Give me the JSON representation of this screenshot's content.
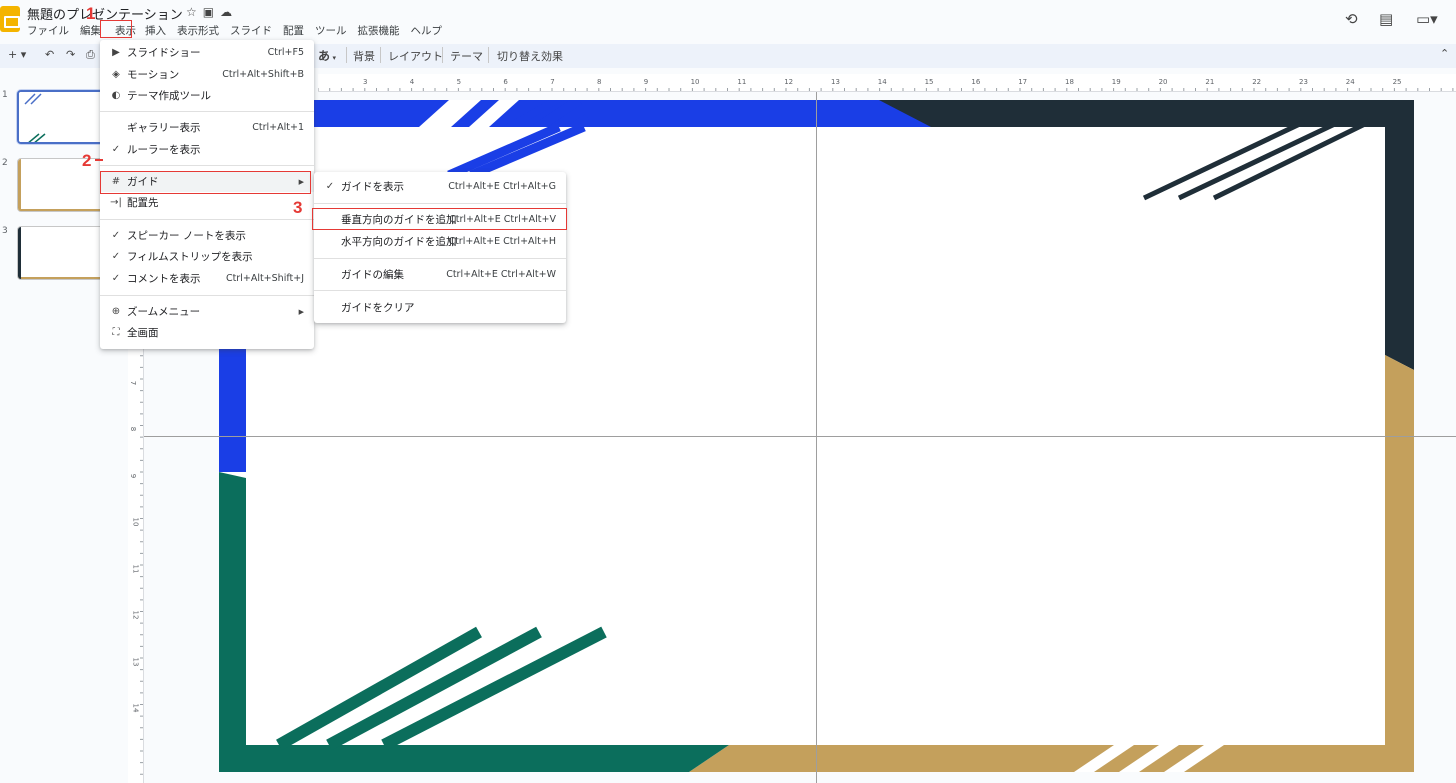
{
  "app": {
    "title": "無題のプレゼンテーション",
    "menu": [
      "ファイル",
      "編集",
      "表示",
      "挿入",
      "表示形式",
      "スライド",
      "配置",
      "ツール",
      "拡張機能",
      "ヘルプ"
    ]
  },
  "toolbar": {
    "font_button": "あ",
    "background": "背景",
    "layout": "レイアウト",
    "theme": "テーマ",
    "transition": "切り替え効果"
  },
  "ruler": {
    "h_ticks": [
      "3",
      "4",
      "5",
      "6",
      "7",
      "8",
      "9",
      "10",
      "11",
      "12",
      "13",
      "14",
      "15",
      "16",
      "17",
      "18",
      "19",
      "20",
      "21",
      "22",
      "23",
      "24",
      "25"
    ],
    "v_ticks": [
      "6",
      "7",
      "8",
      "9",
      "10",
      "11",
      "12",
      "13",
      "14"
    ]
  },
  "slides": [
    "1",
    "2",
    "3"
  ],
  "view_menu": {
    "items": [
      {
        "icon": "play-icon",
        "label": "スライドショー",
        "shortcut": "Ctrl+F5"
      },
      {
        "icon": "motion-icon",
        "label": "モーション",
        "shortcut": "Ctrl+Alt+Shift+B"
      },
      {
        "icon": "palette-icon",
        "label": "テーマ作成ツール",
        "shortcut": ""
      },
      {
        "icon": "",
        "label": "ギャラリー表示",
        "shortcut": "Ctrl+Alt+1"
      },
      {
        "icon": "check-icon",
        "label": "ルーラーを表示",
        "shortcut": ""
      },
      {
        "icon": "guide-icon",
        "label": "ガイド",
        "shortcut": ""
      },
      {
        "icon": "snap-icon",
        "label": "配置先",
        "shortcut": ""
      },
      {
        "icon": "check-icon",
        "label": "スピーカー ノートを表示",
        "shortcut": ""
      },
      {
        "icon": "check-icon",
        "label": "フィルムストリップを表示",
        "shortcut": ""
      },
      {
        "icon": "check-icon",
        "label": "コメントを表示",
        "shortcut": "Ctrl+Alt+Shift+J"
      },
      {
        "icon": "zoom-icon",
        "label": "ズームメニュー",
        "shortcut": ""
      },
      {
        "icon": "fullscreen-icon",
        "label": "全画面",
        "shortcut": ""
      }
    ]
  },
  "guide_menu": {
    "items": [
      {
        "label": "ガイドを表示",
        "shortcut": "Ctrl+Alt+E Ctrl+Alt+G"
      },
      {
        "label": "垂直方向のガイドを追加",
        "shortcut": "Ctrl+Alt+E Ctrl+Alt+V"
      },
      {
        "label": "水平方向のガイドを追加",
        "shortcut": "Ctrl+Alt+E Ctrl+Alt+H"
      },
      {
        "label": "ガイドの編集",
        "shortcut": "Ctrl+Alt+E Ctrl+Alt+W"
      },
      {
        "label": "ガイドをクリア",
        "shortcut": ""
      }
    ]
  },
  "annotations": [
    "1",
    "2",
    "3"
  ],
  "colors": {
    "accent_red": "#e53935",
    "slide_blue": "#1a3ee6",
    "slide_dark": "#1f2e38",
    "slide_gold": "#c4a05c",
    "slide_green": "#0b6e5c"
  }
}
